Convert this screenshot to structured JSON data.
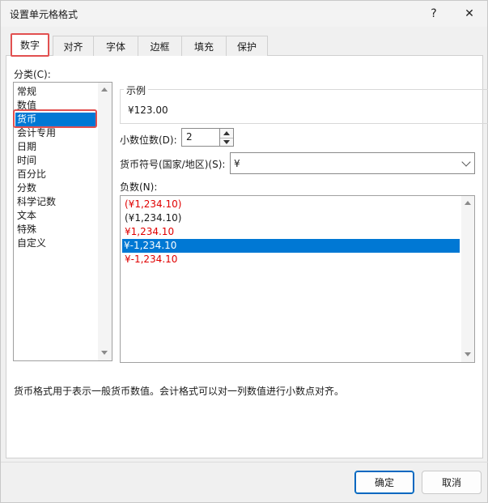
{
  "dialog": {
    "title": "设置单元格格式",
    "help_glyph": "?",
    "close_glyph": "✕"
  },
  "tabs": [
    {
      "label": "数字",
      "active": true
    },
    {
      "label": "对齐",
      "active": false
    },
    {
      "label": "字体",
      "active": false
    },
    {
      "label": "边框",
      "active": false
    },
    {
      "label": "填充",
      "active": false
    },
    {
      "label": "保护",
      "active": false
    }
  ],
  "category": {
    "label": "分类(C):",
    "items": [
      "常规",
      "数值",
      "货币",
      "会计专用",
      "日期",
      "时间",
      "百分比",
      "分数",
      "科学记数",
      "文本",
      "特殊",
      "自定义"
    ],
    "selected": "货币"
  },
  "sample": {
    "label": "示例",
    "value": "¥123.00"
  },
  "decimal_places": {
    "label": "小数位数(D):",
    "value": "2"
  },
  "currency_symbol": {
    "label": "货币符号(国家/地区)(S):",
    "value": "¥"
  },
  "negative_numbers": {
    "label": "负数(N):",
    "items": [
      {
        "text": "(¥1,234.10)",
        "color": "#e00000"
      },
      {
        "text": "(¥1,234.10)",
        "color": "#1a1a1a"
      },
      {
        "text": "¥1,234.10",
        "color": "#e00000"
      },
      {
        "text": "¥-1,234.10",
        "color": "#ffffff"
      },
      {
        "text": "¥-1,234.10",
        "color": "#e00000"
      }
    ],
    "selected_index": 3
  },
  "description": "货币格式用于表示一般货币数值。会计格式可以对一列数值进行小数点对齐。",
  "buttons": {
    "ok": "确定",
    "cancel": "取消"
  },
  "colors": {
    "accent": "#0078d4",
    "highlight_outline": "#e25050",
    "negative_red": "#e00000"
  }
}
